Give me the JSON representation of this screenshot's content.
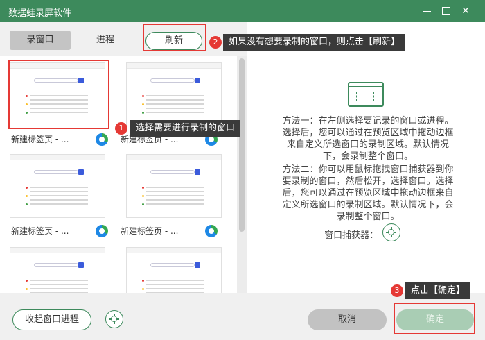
{
  "window": {
    "title": "数据蛙录屏软件",
    "controls": {
      "minimize": "minimize-icon",
      "maximize": "maximize-icon",
      "close": "close-icon"
    },
    "accent_color": "#3d8a5c",
    "annotation_color": "#e53935"
  },
  "tabs": [
    {
      "label": "录窗口",
      "active": true
    },
    {
      "label": "进程",
      "active": false
    },
    {
      "label": "刷新",
      "active": false
    }
  ],
  "windows": [
    {
      "label": "新建标签页 - ...",
      "icon": "edge-icon",
      "selected": true
    },
    {
      "label": "新建标签页 - ...",
      "icon": "edge-icon",
      "selected": false
    },
    {
      "label": "新建标签页 - ...",
      "icon": "edge-icon",
      "selected": false
    },
    {
      "label": "新建标签页 - ...",
      "icon": "edge-icon",
      "selected": false
    },
    {
      "label": "",
      "icon": "",
      "selected": false
    },
    {
      "label": "",
      "icon": "",
      "selected": false
    }
  ],
  "annotations": [
    {
      "number": "1",
      "text": "选择需要进行录制的窗口"
    },
    {
      "number": "2",
      "text": "如果没有想要录制的窗口，则点击【刷新】"
    },
    {
      "number": "3",
      "text": "点击【确定】"
    }
  ],
  "right_panel": {
    "icon": "window-picker-icon",
    "method1": [
      "方法一：在左侧选择要记录的窗口或进程。",
      "选择后，您可以通过在预览区域中拖动边框",
      "来自定义所选窗口的录制区域。默认情况",
      "下，会录制整个窗口。"
    ],
    "method2": [
      "方法二：你可以用鼠标拖拽窗口捕获器到你",
      "要录制的窗口，然后松开，选择窗口。选择",
      "后，您可以通过在预览区域中拖动边框来自",
      "定义所选窗口的录制区域。默认情况下，会",
      "录制整个窗口。"
    ],
    "catcher_label": "窗口捕获器："
  },
  "footer": {
    "collapse_label": "收起窗口进程",
    "cancel_label": "取消",
    "ok_label": "确定"
  }
}
